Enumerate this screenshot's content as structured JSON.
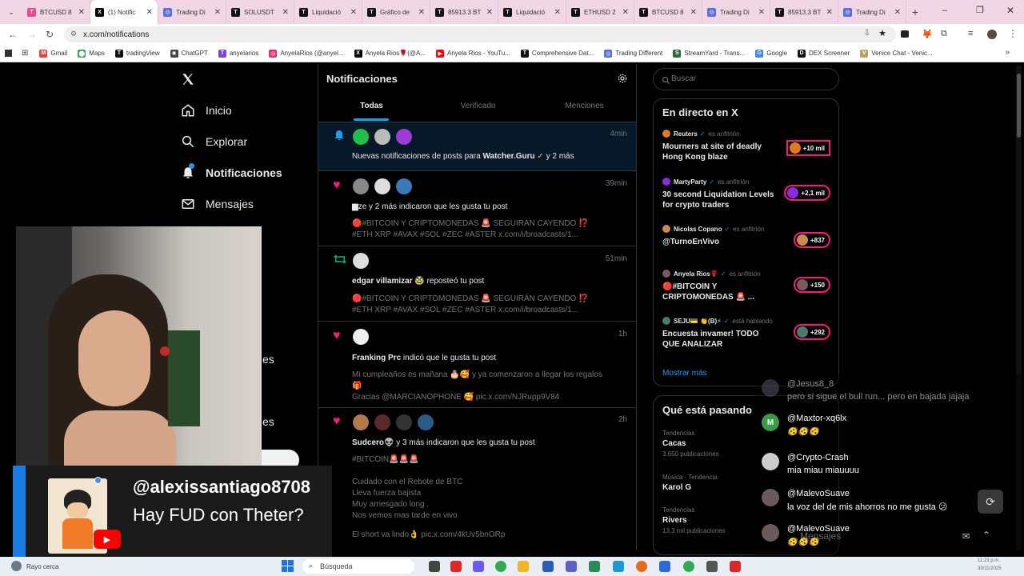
{
  "browser": {
    "tabs": [
      {
        "label": "BTCUSD 8",
        "color": "#e94b8a",
        "glyph": "T"
      },
      {
        "label": "(1) Notific",
        "color": "#000000",
        "glyph": "X",
        "active": true
      },
      {
        "label": "Trading Di",
        "color": "#5b6ee1",
        "glyph": "◎"
      },
      {
        "label": "SOLUSDT",
        "color": "#111111",
        "glyph": "T"
      },
      {
        "label": "Liquidació",
        "color": "#111111",
        "glyph": "T"
      },
      {
        "label": "Gráfico de",
        "color": "#111111",
        "glyph": "T"
      },
      {
        "label": "85913.3 BT",
        "color": "#111111",
        "glyph": "T"
      },
      {
        "label": "Liquidació",
        "color": "#111111",
        "glyph": "T"
      },
      {
        "label": "ETHUSD 2",
        "color": "#111111",
        "glyph": "T"
      },
      {
        "label": "BTCUSD 8",
        "color": "#111111",
        "glyph": "T"
      },
      {
        "label": "Trading Di",
        "color": "#5b6ee1",
        "glyph": "◎"
      },
      {
        "label": "85913.3 BT",
        "color": "#111111",
        "glyph": "T"
      },
      {
        "label": "Trading Di",
        "color": "#5b6ee1",
        "glyph": "◎"
      }
    ],
    "url": "x.com/notifications",
    "bookmarks": [
      {
        "label": "Gmail",
        "color": "#ea4335",
        "glyph": "M"
      },
      {
        "label": "Maps",
        "color": "#34a853",
        "glyph": "⬤"
      },
      {
        "label": "tradingView",
        "color": "#111111",
        "glyph": "T"
      },
      {
        "label": "ChatGPT",
        "color": "#444444",
        "glyph": "✺"
      },
      {
        "label": "anyelarios",
        "color": "#7b3fe4",
        "glyph": "T"
      },
      {
        "label": "AnyelaRios (@anyel...",
        "color": "#e1306c",
        "glyph": "◎"
      },
      {
        "label": "Anyela Rios🌹(@A...",
        "color": "#000000",
        "glyph": "X"
      },
      {
        "label": "Anyela Rios - YouTu...",
        "color": "#ff0000",
        "glyph": "▶"
      },
      {
        "label": "Comprehensive Dat...",
        "color": "#111111",
        "glyph": "T"
      },
      {
        "label": "Trading Different",
        "color": "#5b6ee1",
        "glyph": "◎"
      },
      {
        "label": "StreamYard - Trans...",
        "color": "#2a6b3c",
        "glyph": "S"
      },
      {
        "label": "Google",
        "color": "#4285f4",
        "glyph": "G"
      },
      {
        "label": "DEX Screener",
        "color": "#111111",
        "glyph": "D"
      },
      {
        "label": "Venice Chat - Venic...",
        "color": "#c0a060",
        "glyph": "V"
      }
    ]
  },
  "sidebar": {
    "logo": "X",
    "items": [
      {
        "label": "Inicio",
        "icon": "home-icon"
      },
      {
        "label": "Explorar",
        "icon": "search-icon"
      },
      {
        "label": "Notificaciones",
        "icon": "bell-icon"
      },
      {
        "label": "Mensajes",
        "icon": "mail-icon"
      }
    ],
    "partial_labels": [
      "es",
      "es"
    ]
  },
  "notifications": {
    "title": "Notificaciones",
    "tabs": [
      "Todas",
      "Verificado",
      "Menciones"
    ],
    "items": [
      {
        "time": "4min",
        "text_prefix": "Nuevas notificaciones de posts para ",
        "text_bold": "Watcher.Guru",
        "text_suffix": " y 2 más"
      },
      {
        "time": "39min",
        "main": "▆ze y 2 más indicaron que les gusta tu post",
        "lines": [
          "🔴#BITCOIN Y CRIPTOMONEDAS 🚨 SEGUIRÁN CAYENDO ⁉️",
          "#ETH XRP #AVAX #SOL #ZEC #ASTER x.com/i/broadcasts/1..."
        ]
      },
      {
        "time": "51min",
        "main_bold": "edgar villamizar",
        "main_rest": " 🥸 reposteó tu post",
        "lines": [
          "🔴#BITCOIN Y CRIPTOMONEDAS 🚨 SEGUIRÁN CAYENDO ⁉️",
          "#ETH XRP #AVAX #SOL #ZEC #ASTER x.com/i/broadcasts/1..."
        ]
      },
      {
        "time": "1h",
        "main_bold": "Franking Prc",
        "main_rest": " indicó que le gusta tu post",
        "lines": [
          "Mi cumpleaños es mañana 🎂🥰 y ya comenzaron a llegar los regalos",
          "🎁",
          "Gracias @MARCIANOPHONE 🥰 pic.x.com/NJRupp9V84"
        ]
      },
      {
        "time": "2h",
        "main_bold": "Sudcero",
        "main_rest": "👽 y 3 más indicaron que les gusta tu post",
        "lines": [
          "#BITCOIN🚨🚨🚨",
          "",
          "Cuidado con el Rebote de BTC",
          "Lleva fuerza bajista",
          "Muy arriesgado long .",
          "Nos vemos mas tarde en vivo",
          "",
          "El short va lindo👌 pic.x.com/4kUv5bnORp"
        ]
      }
    ]
  },
  "right": {
    "search_placeholder": "Buscar",
    "live_title": "En directo en X",
    "live": [
      {
        "host": "Reuters",
        "role": "es anfitrión",
        "title": "Mourners at site of deadly Hong Kong blaze",
        "count": "+10 mil",
        "avatar": "#e07a1f"
      },
      {
        "host": "MartyParty",
        "role": "es anfitrión",
        "title": "30 second Liquidation Levels for crypto traders",
        "count": "+2,1 mil",
        "avatar": "#8a2be2"
      },
      {
        "host": "Nicolas Copano",
        "role": "es anfitrión",
        "title": "@TurnoEnVivo",
        "count": "+837",
        "avatar": "#c98a4b"
      },
      {
        "host": "Anyela Rios🌹",
        "role": "es anfitrión",
        "title": "🔴#BITCOIN Y CRIPTOMONEDAS 🚨 ...",
        "count": "+150",
        "avatar": "#7a5a5a"
      },
      {
        "host": "SEJU💳 👏(B)⚡",
        "role": "está hablando",
        "title": "Encuesta invamer! TODO QUE ANALIZAR",
        "count": "+292",
        "avatar": "#4a7a6a"
      }
    ],
    "show_more": "Mostrar más",
    "trending_title": "Qué está pasando",
    "trends": [
      {
        "category": "Tendencias",
        "name": "Cacas",
        "posts": "3.650 publicaciones"
      },
      {
        "category": "Música · Tendencia",
        "name": "Karol G",
        "posts": ""
      },
      {
        "category": "Tendencias",
        "name": "Rivers",
        "posts": "13,3 mil publicaciones"
      }
    ]
  },
  "chat": [
    {
      "name": "@Jesus8_8",
      "text": "pero si sigue el bull run... pero en bajada jajaja",
      "avatar": "#555566",
      "faded": true
    },
    {
      "name": "@Maxtor-xq6lx",
      "text": "🫨🫨🫨",
      "avatar": "#3a9a4a",
      "letter": "M"
    },
    {
      "name": "@Crypto-Crash",
      "text": "mia miau miauuuu",
      "avatar": "#cccccc"
    },
    {
      "name": "@MalevoSuave",
      "text": "la voz del de mis ahorros no me gusta 😕",
      "avatar": "#6a5a5a"
    },
    {
      "name": "@MalevoSuave",
      "text": "🫨🫨🫨",
      "avatar": "#6a5a5a"
    }
  ],
  "lower_third": {
    "username": "@alexissantiago8708",
    "message": "Hay FUD con Theter?"
  },
  "taskbar": {
    "weather": "Rayo cerca",
    "search": "Búsqueda",
    "mensajes_overlay": "Mensajes",
    "time": "11:23 p.m.",
    "date": "30/11/2025"
  }
}
